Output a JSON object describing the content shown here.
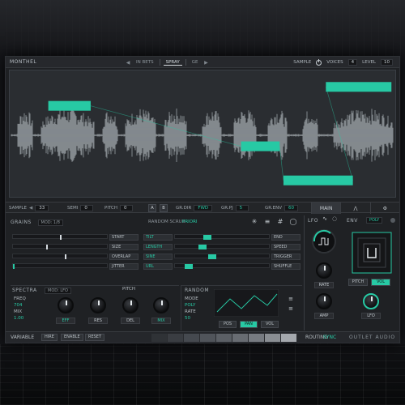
{
  "theme": {
    "accent": "#27c9a4",
    "panel": "#1f2124",
    "waveform": "#9aa0a6"
  },
  "topbar": {
    "brand": "MONTHEL",
    "nav_prev": "◀",
    "nav_next": "▶",
    "tabs": [
      "IN BETS",
      "SPRAY",
      "GE"
    ],
    "sample_mode_label": "SAMPLE",
    "power_label": "BYPASS",
    "voices_label": "VOICES",
    "voices_value": "4",
    "level_label": "LEVEL",
    "level_value": "10"
  },
  "waveform": {
    "regions": [
      {
        "start": 0.1,
        "end": 0.21,
        "level": 0.72
      },
      {
        "start": 0.6,
        "end": 0.7,
        "level": 0.4
      },
      {
        "start": 0.71,
        "end": 0.89,
        "level": 0.13
      },
      {
        "start": 0.82,
        "end": 0.99,
        "level": 0.87
      }
    ]
  },
  "midbar": {
    "sample_label": "SAMPLE",
    "sample_value": "33",
    "semi_label": "SEMI",
    "semi_value": "0",
    "pitch_label": "PITCH",
    "pitch_value": "0",
    "a_label": "A",
    "b_label": "B",
    "gr_dir_label": "GR.DIR",
    "gr_dir_value": "FWD",
    "gr_pj_label": "GR.PJ",
    "gr_pj_value": "5",
    "gr_env_label": "GR.ENV",
    "gr_env_value": "60",
    "tab_main": "MAIN"
  },
  "grains": {
    "title": "GRAINS",
    "mode": "MOD: 1/8",
    "random_label": "RANDOM SCRUB",
    "random_value": "PRIORI",
    "left_labels": [
      "START",
      "SIZE",
      "OVERLAP",
      "JITTER"
    ],
    "mid_labels": [
      "TILT",
      "LENGTH",
      "SINE",
      "URL"
    ],
    "right_labels": [
      "END",
      "SPEED",
      "TRIGGER",
      "SHUFFLE"
    ],
    "sliders": [
      0.5,
      0.35,
      0.55,
      0.0
    ],
    "mid_sliders": [
      0.3,
      0.25,
      0.35,
      0.1
    ]
  },
  "spectra": {
    "title": "SPECTRA",
    "mode": "MOD: LFO",
    "labels": [
      "FREQ",
      "MIX",
      "Q"
    ],
    "values": [
      "704",
      "4",
      "1.00"
    ],
    "pitch_label": "PITCH",
    "knobs": [
      "EFF",
      "RES",
      "DEL",
      "MIX"
    ]
  },
  "random": {
    "title": "RANDOM",
    "mode_label": "MODE",
    "mode_value": "POLY",
    "rate_label": "RATE",
    "rate_value": "50",
    "buttons": [
      "POS",
      "PAN",
      "VOL"
    ],
    "active_button": "PAN"
  },
  "lfo": {
    "title": "LFO",
    "rate_label": "RATE",
    "amp_label": "AMP",
    "env_title": "ENV",
    "env_mode": "POLY",
    "env_buttons": [
      "PITCH",
      "VOL"
    ],
    "env_active": "VOL",
    "lfo_knob_label": "LFO"
  },
  "footer": {
    "section_label": "VARIABLE",
    "buttons": [
      "HIRE",
      "ENABLE",
      "RESET"
    ],
    "routing_label": "ROUTING",
    "routing_value": "SYNC",
    "brand_right": "OUTLET AUDIO"
  }
}
